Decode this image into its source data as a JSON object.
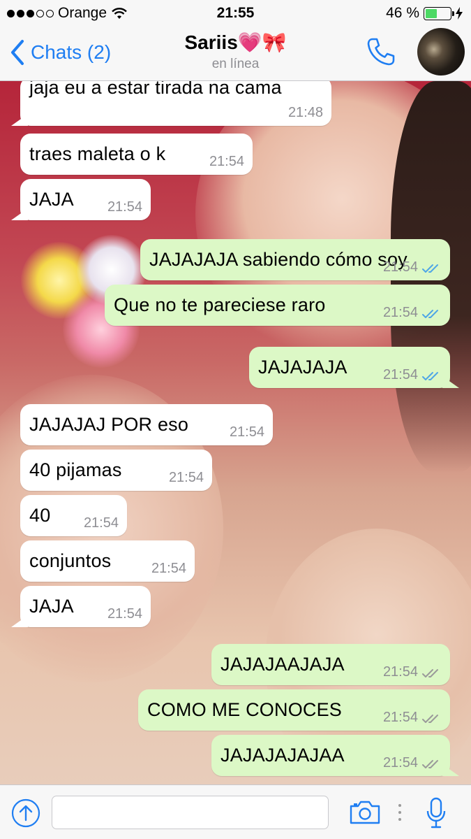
{
  "status_bar": {
    "carrier": "Orange",
    "time": "21:55",
    "battery_percent": "46 %",
    "battery_level": 0.46,
    "signal_bars_filled": 3,
    "signal_bars_total": 5
  },
  "nav": {
    "back_label": "Chats (2)",
    "contact_name": "Sariis💗🎀",
    "contact_status": "en línea"
  },
  "colors": {
    "accent": "#1f7ef2",
    "incoming_bubble": "#ffffff",
    "outgoing_bubble": "#dcf8c6",
    "read_ticks": "#4fa6e6",
    "delivered_ticks": "#9a9a9a"
  },
  "messages": [
    {
      "direction": "in",
      "text": "jaja eu a estar tirada na cama",
      "time": "21:48"
    },
    {
      "direction": "in",
      "text": "traes maleta o k",
      "time": "21:54"
    },
    {
      "direction": "in",
      "text": "JAJA",
      "time": "21:54"
    },
    {
      "direction": "out",
      "text": "JAJAJAJA sabiendo cómo soy",
      "time": "21:54",
      "status": "read"
    },
    {
      "direction": "out",
      "text": "Que no te pareciese raro",
      "time": "21:54",
      "status": "read"
    },
    {
      "direction": "out",
      "text": "JAJAJAJA",
      "time": "21:54",
      "status": "read"
    },
    {
      "direction": "in",
      "text": "JAJAJAJ POR eso",
      "time": "21:54"
    },
    {
      "direction": "in",
      "text": "40  pijamas",
      "time": "21:54"
    },
    {
      "direction": "in",
      "text": "40",
      "time": "21:54"
    },
    {
      "direction": "in",
      "text": "conjuntos",
      "time": "21:54"
    },
    {
      "direction": "in",
      "text": "JAJA",
      "time": "21:54"
    },
    {
      "direction": "out",
      "text": "JAJAJAAJAJA",
      "time": "21:54",
      "status": "delivered"
    },
    {
      "direction": "out",
      "text": "COMO ME CONOCES",
      "time": "21:54",
      "status": "delivered"
    },
    {
      "direction": "out",
      "text": "JAJAJAJAJAA",
      "time": "21:54",
      "status": "delivered"
    }
  ],
  "input": {
    "value": "",
    "placeholder": ""
  },
  "icons": {
    "share": "share-arrow-icon",
    "camera": "camera-icon",
    "more": "more-dots-icon",
    "mic": "microphone-icon"
  }
}
